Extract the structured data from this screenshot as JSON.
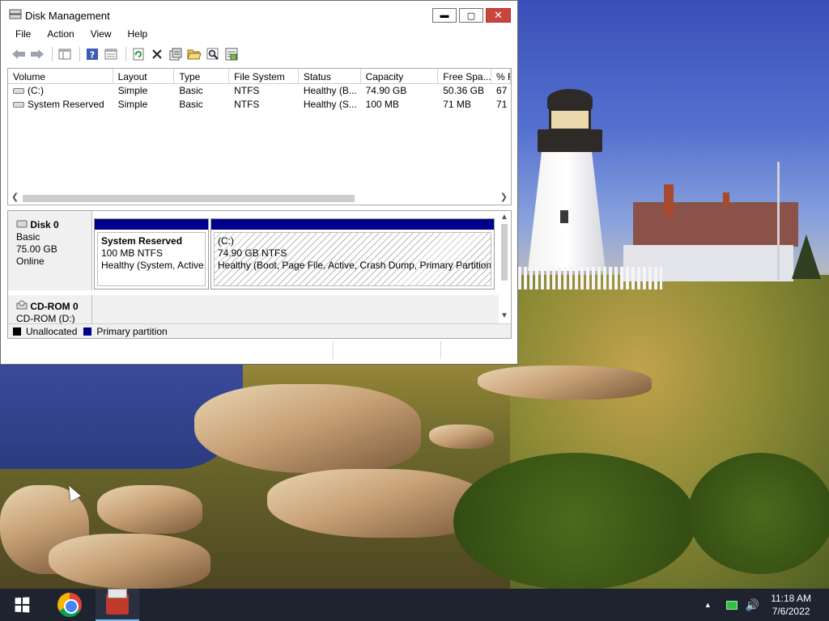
{
  "window": {
    "title": "Disk Management",
    "controls": {
      "minimize": "▬",
      "maximize": "▢",
      "close": "✕"
    }
  },
  "menu": [
    "File",
    "Action",
    "View",
    "Help"
  ],
  "toolbar": {
    "icons": [
      "back-arrow-icon",
      "forward-arrow-icon",
      "show-hide-console-tree-icon",
      "help-icon",
      "properties-list-icon",
      "refresh-icon",
      "delete-icon",
      "properties-icon",
      "open-icon",
      "search-icon",
      "export-list-icon"
    ]
  },
  "volumes": {
    "columns": [
      "Volume",
      "Layout",
      "Type",
      "File System",
      "Status",
      "Capacity",
      "Free Spa...",
      "% F"
    ],
    "rows": [
      [
        "(C:)",
        "Simple",
        "Basic",
        "NTFS",
        "Healthy (B...",
        "74.90 GB",
        "50.36 GB",
        "67"
      ],
      [
        "System Reserved",
        "Simple",
        "Basic",
        "NTFS",
        "Healthy (S...",
        "100 MB",
        "71 MB",
        "71"
      ]
    ]
  },
  "disk0": {
    "name": "Disk 0",
    "type": "Basic",
    "size": "75.00 GB",
    "state": "Online",
    "partitions": [
      {
        "name": "System Reserved",
        "size": "100 MB NTFS",
        "status": "Healthy (System, Active, Primar"
      },
      {
        "name": "(C:)",
        "size": "74.90 GB NTFS",
        "status": "Healthy (Boot, Page File, Active, Crash Dump, Primary Partition)"
      }
    ]
  },
  "cdrom0": {
    "name": "CD-ROM 0",
    "drive": "CD-ROM (D:)"
  },
  "legend": {
    "unallocated": "Unallocated",
    "primary": "Primary partition",
    "colors": {
      "unallocated": "#000000",
      "primary": "#00008b"
    }
  },
  "taskbar": {
    "apps": [
      "start-icon",
      "chrome-icon",
      "disk-management-icon"
    ],
    "time": "11:18 AM",
    "date": "7/6/2022"
  }
}
